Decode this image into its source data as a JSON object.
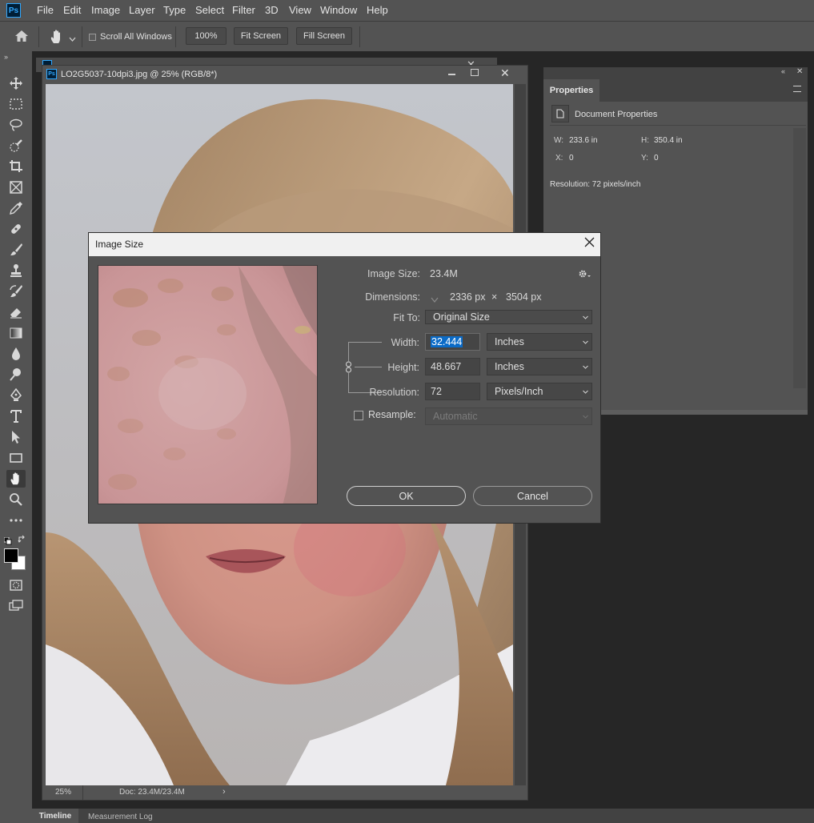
{
  "app": {
    "logo": "Ps"
  },
  "menu": [
    "File",
    "Edit",
    "Image",
    "Layer",
    "Type",
    "Select",
    "Filter",
    "3D",
    "View",
    "Window",
    "Help"
  ],
  "options": {
    "scroll_all_label": "Scroll All Windows",
    "zoom": "100%",
    "fit_screen": "Fit Screen",
    "fill_screen": "Fill Screen"
  },
  "document": {
    "title": "LO2G5037-10dpi3.jpg @ 25% (RGB/8*)",
    "zoom": "25%",
    "doc_info": "Doc: 23.4M/23.4M"
  },
  "properties": {
    "tab": "Properties",
    "section": "Document Properties",
    "w_label": "W:",
    "w_value": "233.6 in",
    "h_label": "H:",
    "h_value": "350.4 in",
    "x_label": "X:",
    "x_value": "0",
    "y_label": "Y:",
    "y_value": "0",
    "resolution": "Resolution: 72 pixels/inch"
  },
  "dialog": {
    "title": "Image Size",
    "image_size_label": "Image Size:",
    "image_size_value": "23.4M",
    "dimensions_label": "Dimensions:",
    "dim_w": "2336 px",
    "dim_x": "×",
    "dim_h": "3504 px",
    "fit_to_label": "Fit To:",
    "fit_to_value": "Original Size",
    "width_label": "Width:",
    "width_value": "32.444",
    "width_unit": "Inches",
    "height_label": "Height:",
    "height_value": "48.667",
    "height_unit": "Inches",
    "resolution_label": "Resolution:",
    "resolution_value": "72",
    "resolution_unit": "Pixels/Inch",
    "resample_label": "Resample:",
    "resample_value": "Automatic",
    "ok": "OK",
    "cancel": "Cancel"
  },
  "bottom_tabs": [
    "Timeline",
    "Measurement Log"
  ],
  "colors": {
    "accent": "#31a8ff",
    "selection": "#0b6bc7",
    "chrome": "#535353",
    "dark": "#262626"
  }
}
